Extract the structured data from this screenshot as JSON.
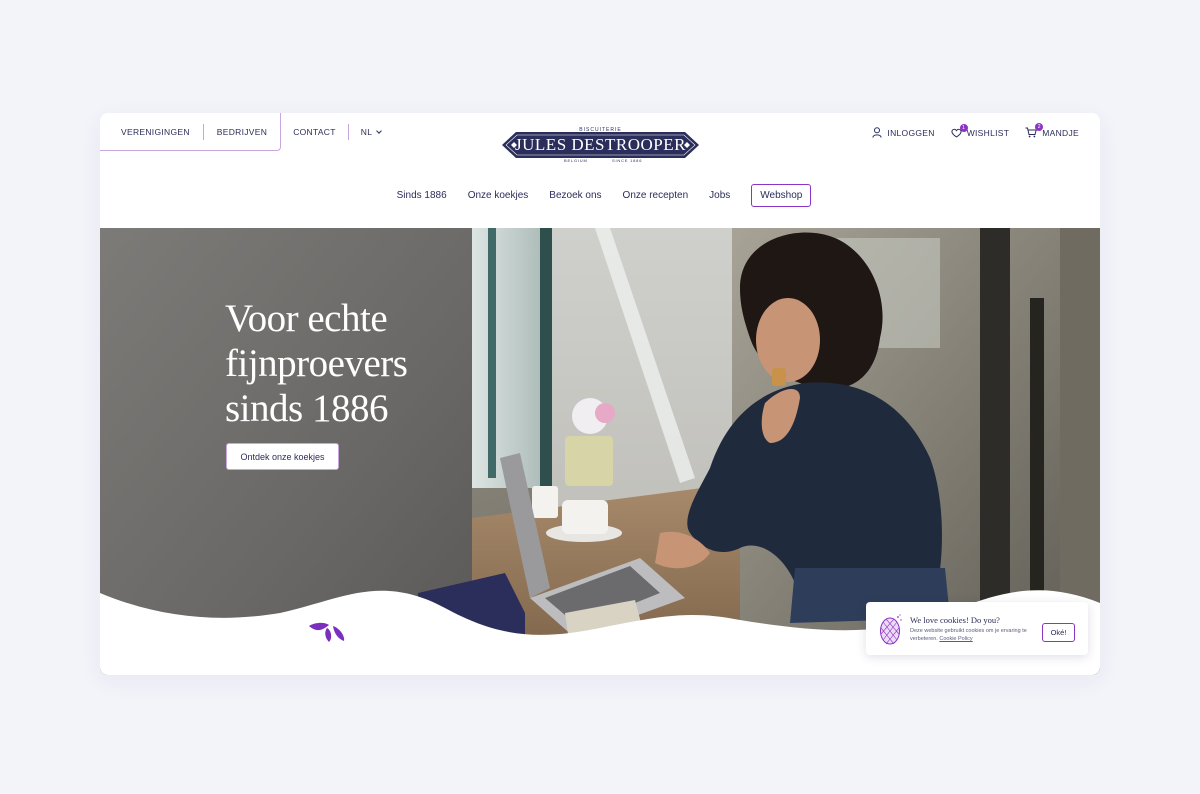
{
  "top_nav": {
    "items": [
      "VERENIGINGEN",
      "BEDRIJVEN",
      "CONTACT"
    ],
    "language": "NL"
  },
  "logo": {
    "kicker": "BISCUITERIE",
    "brand": "JULES DESTROOPER",
    "country": "BELGIUM",
    "since": "SINCE 1886"
  },
  "account_nav": {
    "login": "INLOGGEN",
    "wishlist": "WISHLIST",
    "wishlist_count": "1",
    "cart": "MANDJE",
    "cart_count": "2"
  },
  "main_nav": {
    "items": [
      "Sinds 1886",
      "Onze koekjes",
      "Bezoek ons",
      "Onze recepten",
      "Jobs"
    ],
    "webshop": "Webshop"
  },
  "hero": {
    "title": "Voor echte fijnproevers sinds 1886",
    "cta": "Ontdek onze koekjes"
  },
  "cookie_banner": {
    "title": "We love cookies! Do you?",
    "body": "Deze website gebruikt cookies om je ervaring te verbeteren.",
    "link": "Cookie Policy",
    "button": "Oké!"
  },
  "colors": {
    "navy": "#2b2d5a",
    "accent": "#8b35c6",
    "border_lilac": "#c7a7dd",
    "page_bg": "#f3f4fa"
  },
  "icons": [
    "user-icon",
    "heart-icon",
    "cart-icon",
    "chevron-down-icon",
    "drop-logo-icon",
    "waffle-cookie-icon"
  ]
}
